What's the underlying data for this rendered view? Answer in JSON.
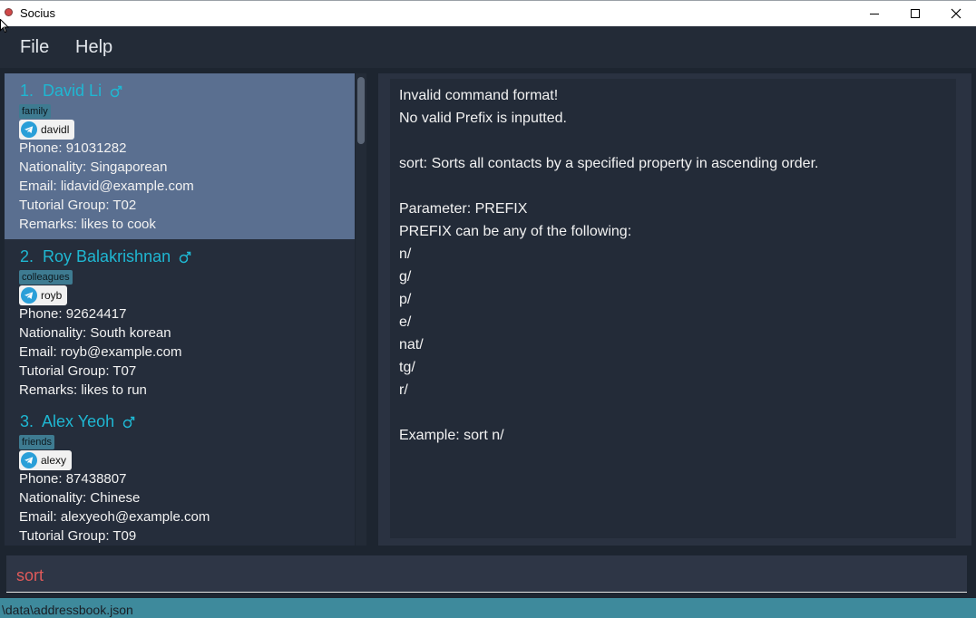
{
  "window": {
    "title": "Socius"
  },
  "menu": {
    "file": "File",
    "help": "Help"
  },
  "contacts": [
    {
      "index": "1.",
      "name": "David Li",
      "gender_icon": "male-icon",
      "tag": "family",
      "telegram": "davidl",
      "phone": "Phone: 91031282",
      "nationality": "Nationality: Singaporean",
      "email": "Email: lidavid@example.com",
      "tutorial_group": "Tutorial Group: T02",
      "remarks": "Remarks: likes to cook"
    },
    {
      "index": "2.",
      "name": "Roy Balakrishnan",
      "gender_icon": "male-icon",
      "tag": "colleagues",
      "telegram": "royb",
      "phone": "Phone: 92624417",
      "nationality": "Nationality: South korean",
      "email": "Email: royb@example.com",
      "tutorial_group": "Tutorial Group: T07",
      "remarks": "Remarks: likes to run"
    },
    {
      "index": "3.",
      "name": "Alex Yeoh",
      "gender_icon": "male-icon",
      "tag": "friends",
      "telegram": "alexy",
      "phone": "Phone: 87438807",
      "nationality": "Nationality: Chinese",
      "email": "Email: alexyeoh@example.com",
      "tutorial_group": "Tutorial Group: T09"
    }
  ],
  "result_lines": [
    "Invalid command format!",
    "No valid Prefix is inputted.",
    "",
    "sort: Sorts all contacts by a specified property in ascending order.",
    "",
    "Parameter: PREFIX",
    "PREFIX can be any of the following:",
    "n/",
    "g/",
    "p/",
    "e/",
    "nat/",
    "tg/",
    "r/",
    "",
    "Example: sort n/"
  ],
  "command_input": {
    "value": "sort"
  },
  "status_bar": {
    "path": "\\data\\addressbook.json"
  },
  "colors": {
    "accent_name": "#1fb7d2",
    "selected_card": "#5a6f90",
    "tag_bg": "#3e7b91",
    "command_text": "#e05a5a",
    "status_bar": "#3e8a9c"
  }
}
